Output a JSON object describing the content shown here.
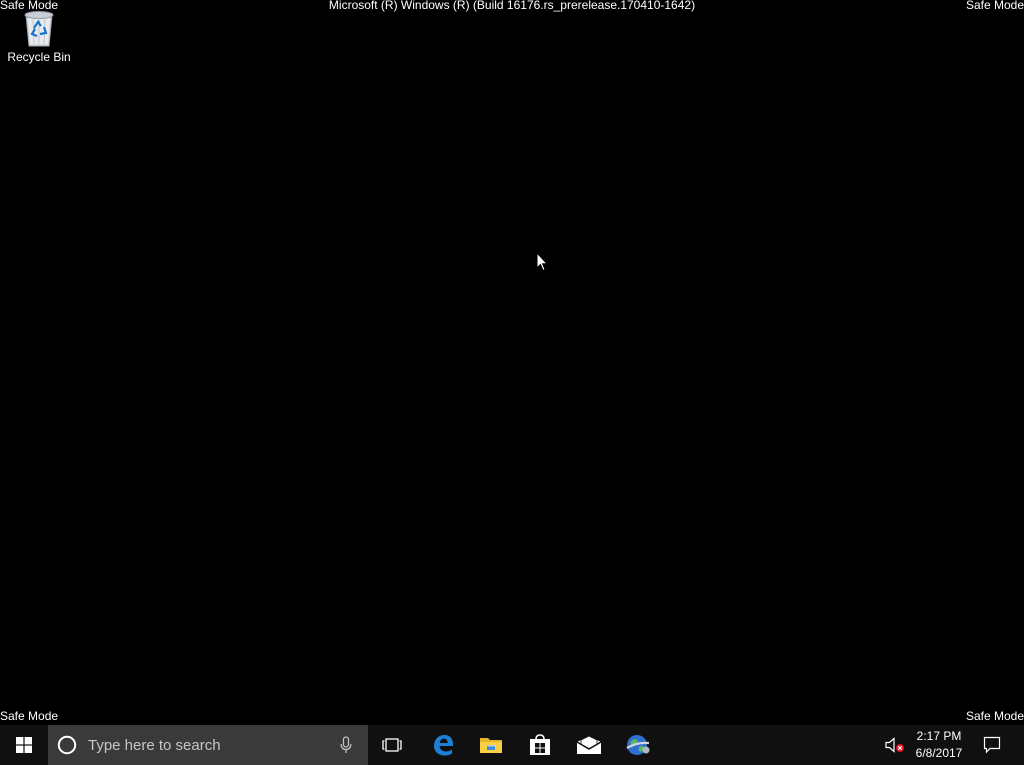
{
  "desktop": {
    "watermark": "Safe Mode",
    "build_title": "Microsoft (R) Windows (R) (Build 16176.rs_prerelease.170410-1642)",
    "background_color": "#000000",
    "icons": [
      {
        "label": "Recycle Bin",
        "icon": "recycle-bin-icon"
      }
    ]
  },
  "taskbar": {
    "background_color": "#101010",
    "start_icon": "windows-logo-icon",
    "search": {
      "placeholder": "Type here to search",
      "left_icon": "cortana-circle-icon",
      "right_icon": "microphone-icon"
    },
    "pinned": [
      {
        "icon": "task-view-icon"
      },
      {
        "icon": "edge-icon"
      },
      {
        "icon": "file-explorer-icon"
      },
      {
        "icon": "store-icon"
      },
      {
        "icon": "mail-icon"
      },
      {
        "icon": "globe-app-icon"
      }
    ],
    "tray": {
      "volume_icon": "volume-muted-icon",
      "time": "2:17 PM",
      "date": "6/8/2017",
      "action_center_icon": "action-center-icon"
    }
  }
}
